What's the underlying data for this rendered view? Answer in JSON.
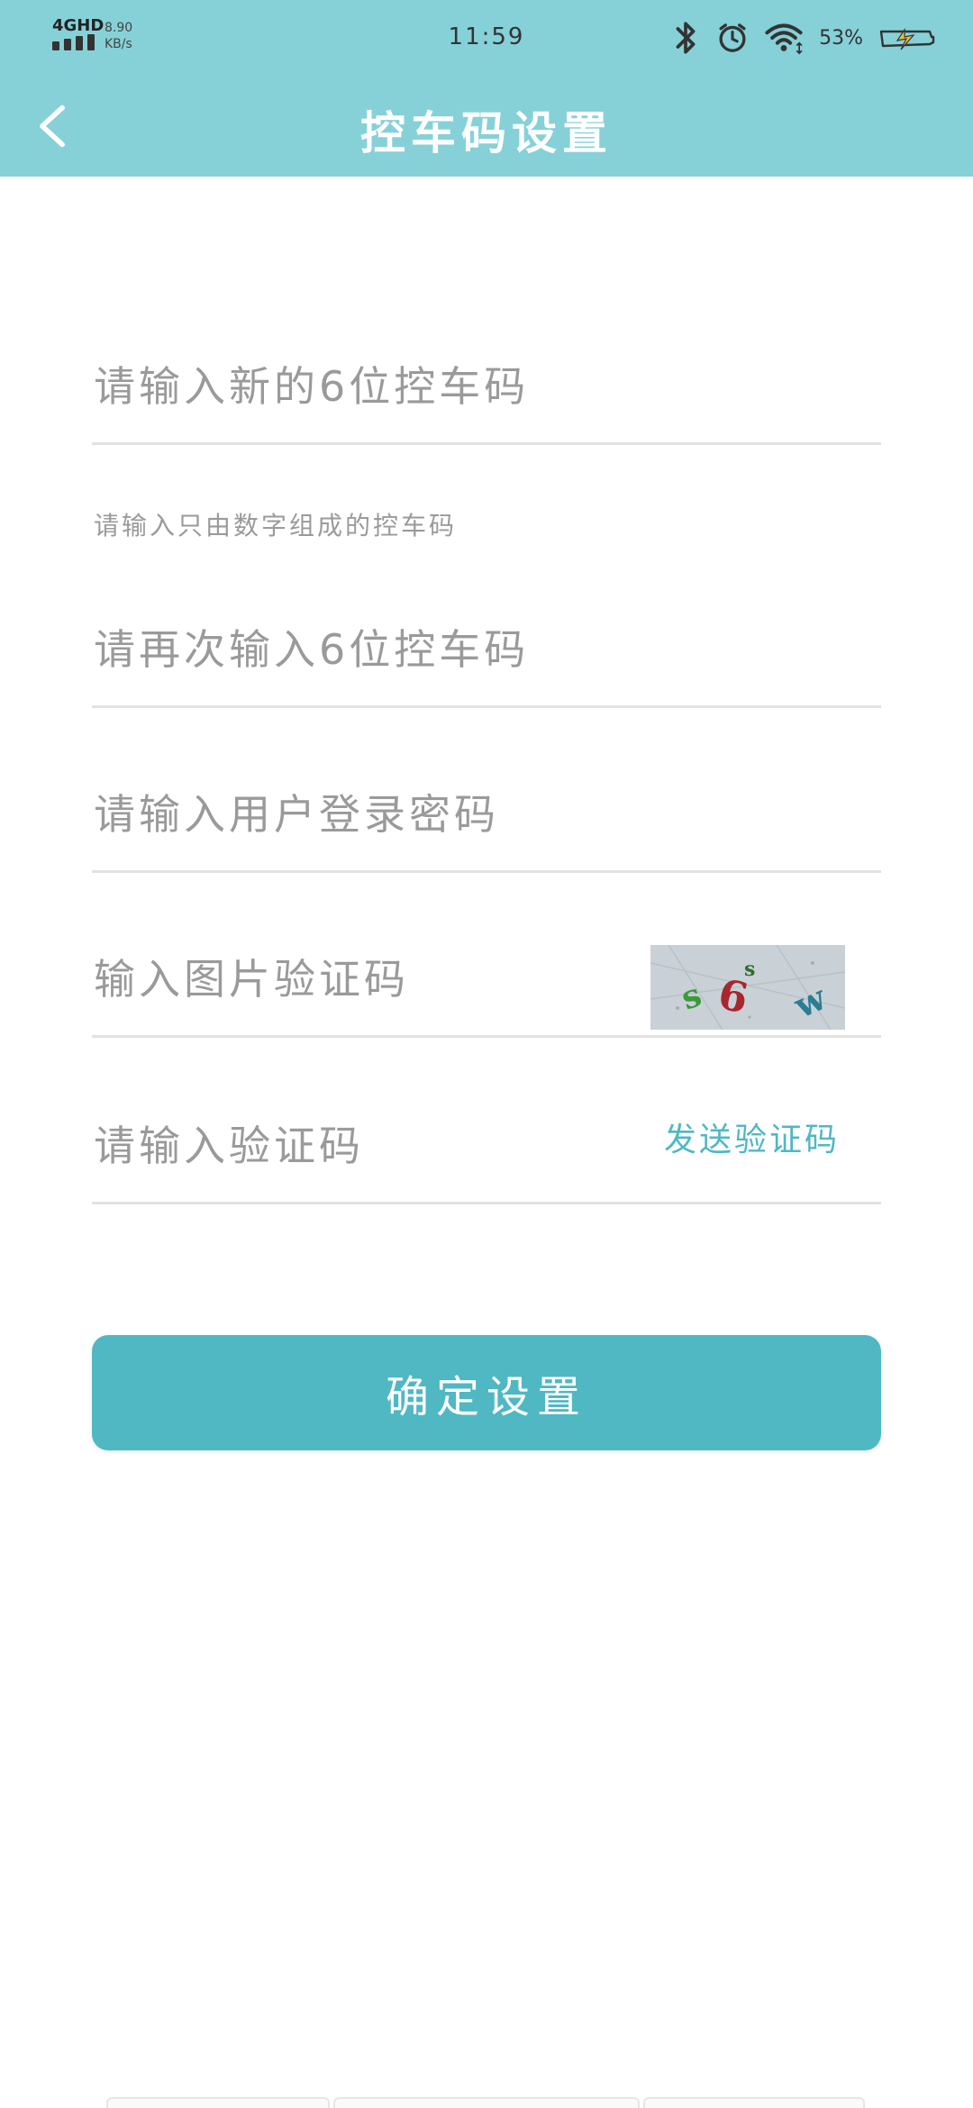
{
  "status_bar": {
    "network": "4GHD",
    "speed_value": "8.90",
    "speed_unit": "KB/s",
    "time": "11:59",
    "battery_percent": "53%",
    "icons": [
      "bluetooth-icon",
      "alarm-icon",
      "wifi-icon",
      "battery-charging-icon"
    ]
  },
  "header": {
    "title": "控车码设置",
    "back_icon": "chevron-left-icon"
  },
  "form": {
    "new_code": {
      "placeholder": "请输入新的6位控车码",
      "value": ""
    },
    "hint": "请输入只由数字组成的控车码",
    "confirm_code": {
      "placeholder": "请再次输入6位控车码",
      "value": ""
    },
    "login_password": {
      "placeholder": "请输入用户登录密码",
      "value": ""
    },
    "image_captcha": {
      "placeholder": "输入图片验证码",
      "value": "",
      "captcha_text": "s6w"
    },
    "sms_code": {
      "placeholder": "请输入验证码",
      "value": "",
      "send_label": "发送验证码"
    }
  },
  "actions": {
    "confirm_label": "确定设置"
  },
  "colors": {
    "header_bg": "#86d1d8",
    "accent": "#4fb8c3",
    "placeholder": "#9a9a9a",
    "divider": "#e2e2e2"
  }
}
